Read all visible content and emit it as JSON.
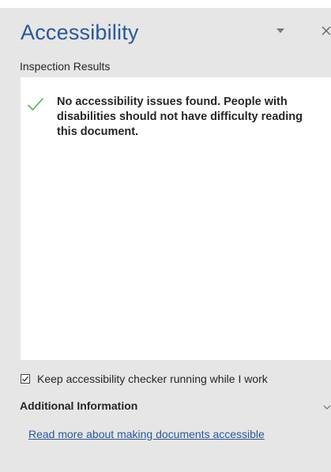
{
  "pane": {
    "title": "Accessibility",
    "accent_color": "#2b579a"
  },
  "inspection": {
    "heading": "Inspection Results",
    "result_message": "No accessibility issues found. People with disabilities should not have difficulty reading this document.",
    "result_icon": "checkmark-icon",
    "result_color": "#4caf50"
  },
  "options": {
    "keep_running_label": "Keep accessibility checker running while I work",
    "keep_running_checked": true
  },
  "additional": {
    "heading": "Additional Information",
    "link_text": "Read more about making documents accessible"
  }
}
